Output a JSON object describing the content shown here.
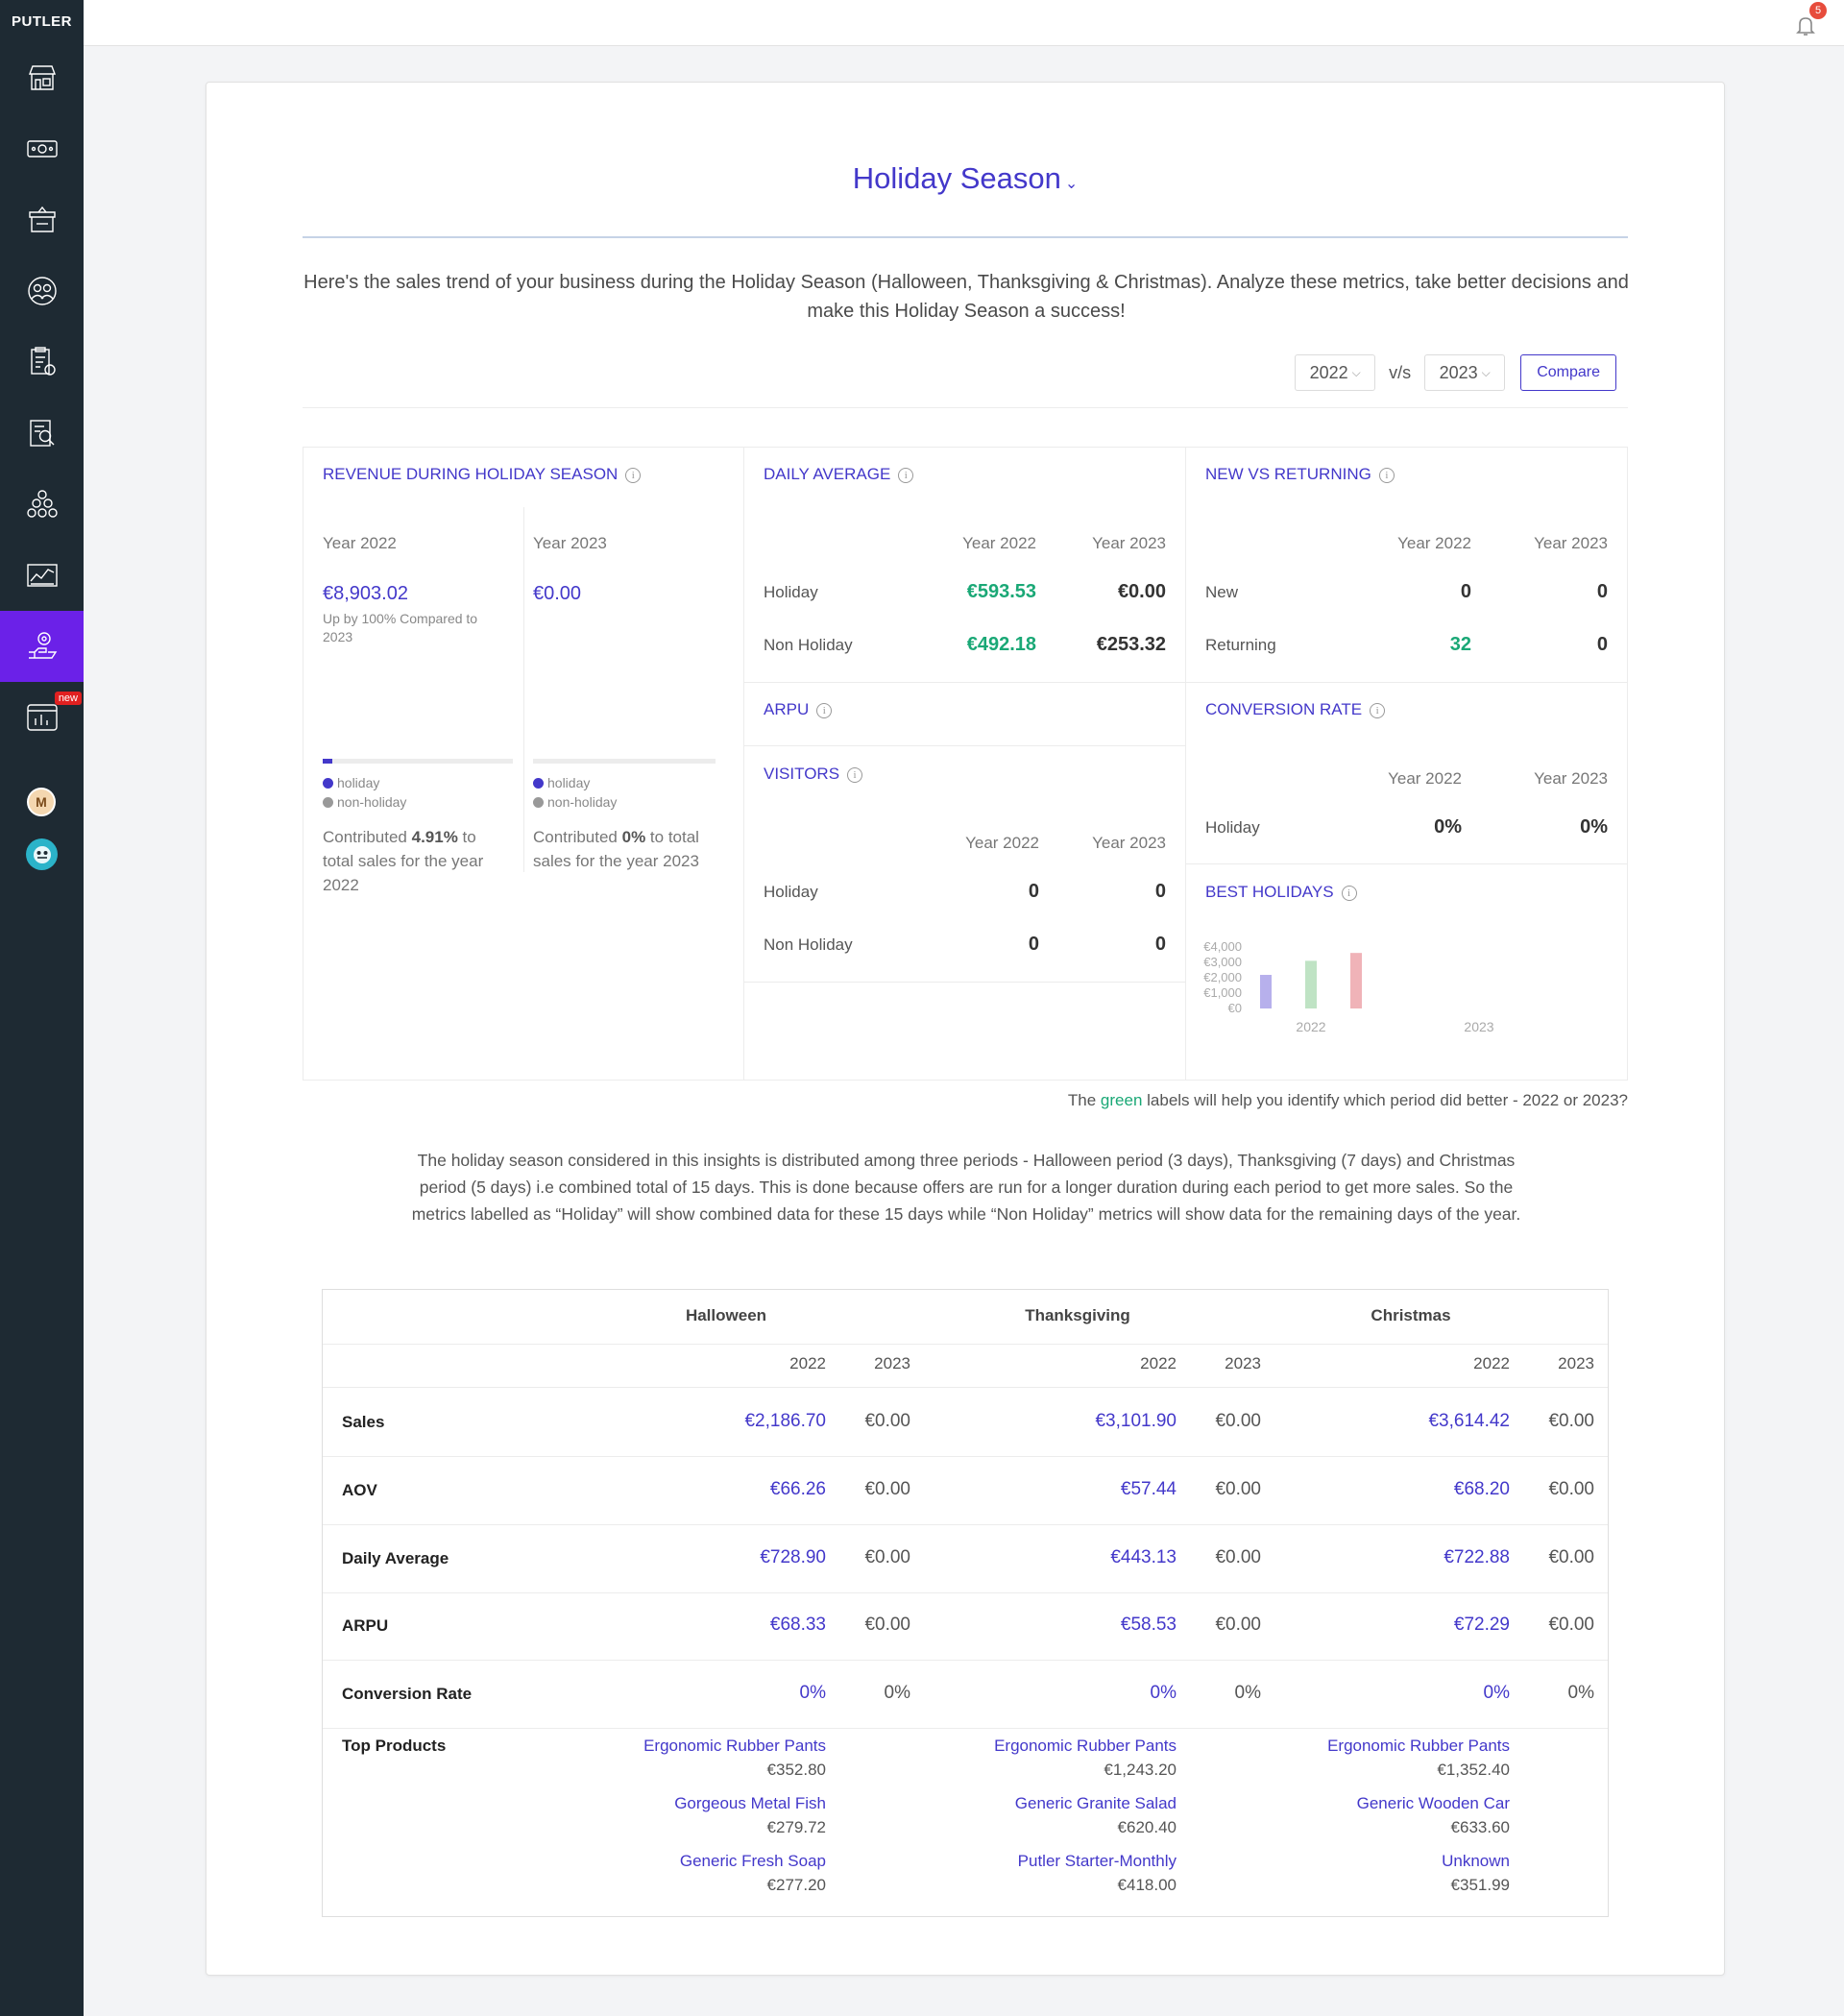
{
  "brand": "PUTLER",
  "sidebar": {
    "items": [
      {
        "icon": "store-icon"
      },
      {
        "icon": "money-icon"
      },
      {
        "icon": "product-box-icon"
      },
      {
        "icon": "customers-icon"
      },
      {
        "icon": "reports-icon"
      },
      {
        "icon": "audit-icon"
      },
      {
        "icon": "subscriptions-icon"
      },
      {
        "icon": "trend-chart-icon"
      },
      {
        "icon": "insights-icon",
        "active": true
      },
      {
        "icon": "dashboard-chart-icon",
        "badge": "new"
      }
    ],
    "avatar_letter": "M"
  },
  "topbar": {
    "notification_count": "5"
  },
  "header": {
    "title": "Holiday Season",
    "intro": "Here's the sales trend of your business during the Holiday Season (Halloween, Thanksgiving & Christmas). Analyze these metrics, take better decisions and make this Holiday Season a success!"
  },
  "compare": {
    "year_a": "2022",
    "vs": "v/s",
    "year_b": "2023",
    "button": "Compare"
  },
  "revenue": {
    "title": "REVENUE DURING HOLIDAY SEASON",
    "y1_label": "Year 2022",
    "y2_label": "Year 2023",
    "y1_value": "€8,903.02",
    "y2_value": "€0.00",
    "y1_sub": "Up by 100% Compared to 2023",
    "y1_holiday_share": 0.0491,
    "y2_holiday_share": 0,
    "legend_holiday": "holiday",
    "legend_nonholiday": "non-holiday",
    "y1_contrib_pre": "Contributed ",
    "y1_contrib_pct": "4.91%",
    "y1_contrib_post": " to total sales for the year 2022",
    "y2_contrib_pre": "Contributed ",
    "y2_contrib_pct": "0%",
    "y2_contrib_post": " to total sales for the year 2023"
  },
  "daily_average": {
    "title": "DAILY AVERAGE",
    "col1": "Year 2022",
    "col2": "Year 2023",
    "rows": [
      {
        "label": "Holiday",
        "v1": "€593.53",
        "v2": "€0.00"
      },
      {
        "label": "Non Holiday",
        "v1": "€492.18",
        "v2": "€253.32"
      }
    ]
  },
  "arpu": {
    "title": "ARPU"
  },
  "visitors": {
    "title": "VISITORS",
    "col1": "Year 2022",
    "col2": "Year 2023",
    "rows": [
      {
        "label": "Holiday",
        "v1": "0",
        "v2": "0"
      },
      {
        "label": "Non Holiday",
        "v1": "0",
        "v2": "0"
      }
    ]
  },
  "new_vs_returning": {
    "title": "NEW VS RETURNING",
    "col1": "Year 2022",
    "col2": "Year 2023",
    "rows": [
      {
        "label": "New",
        "v1": "0",
        "v2": "0"
      },
      {
        "label": "Returning",
        "v1": "32",
        "v2": "0"
      }
    ]
  },
  "conversion_rate": {
    "title": "CONVERSION RATE",
    "col1": "Year 2022",
    "col2": "Year 2023",
    "rows": [
      {
        "label": "Holiday",
        "v1": "0%",
        "v2": "0%"
      }
    ]
  },
  "best_holidays": {
    "title": "BEST HOLIDAYS"
  },
  "chart_data": {
    "type": "bar",
    "categories": [
      "2022",
      "2023"
    ],
    "y_ticks": [
      "€4,000",
      "€3,000",
      "€2,000",
      "€1,000",
      "€0"
    ],
    "ylim": [
      0,
      4000
    ],
    "series": [
      {
        "color": "#b7b0ec",
        "values": [
          2186.7,
          0
        ]
      },
      {
        "color": "#bfe3c4",
        "values": [
          3101.9,
          0
        ]
      },
      {
        "color": "#f0b3b8",
        "values": [
          3614.42,
          0
        ]
      }
    ]
  },
  "notes": {
    "green_pre": "The ",
    "green_word": "green",
    "green_post": " labels will help you identify which period did better - 2022 or 2023?",
    "description": "The holiday season considered in this insights is distributed among three periods - Halloween period (3 days), Thanksgiving (7 days) and Christmas period (5 days) i.e combined total of 15 days. This is done because offers are run for a longer duration during each period to get more sales. So the metrics labelled as “Holiday” will show combined data for these 15 days while “Non Holiday” metrics will show data for the remaining days of the year."
  },
  "table": {
    "groups": [
      "Halloween",
      "Thanksgiving",
      "Christmas"
    ],
    "years": [
      "2022",
      "2023"
    ],
    "rows": [
      {
        "label": "Sales",
        "values": [
          "€2,186.70",
          "€0.00",
          "€3,101.90",
          "€0.00",
          "€3,614.42",
          "€0.00"
        ]
      },
      {
        "label": "AOV",
        "values": [
          "€66.26",
          "€0.00",
          "€57.44",
          "€0.00",
          "€68.20",
          "€0.00"
        ]
      },
      {
        "label": "Daily Average",
        "values": [
          "€728.90",
          "€0.00",
          "€443.13",
          "€0.00",
          "€722.88",
          "€0.00"
        ]
      },
      {
        "label": "ARPU",
        "values": [
          "€68.33",
          "€0.00",
          "€58.53",
          "€0.00",
          "€72.29",
          "€0.00"
        ]
      },
      {
        "label": "Conversion Rate",
        "values": [
          "0%",
          "0%",
          "0%",
          "0%",
          "0%",
          "0%"
        ]
      }
    ],
    "top_products_label": "Top Products",
    "top_products": [
      [
        {
          "name": "Ergonomic Rubber Pants",
          "value": "€352.80"
        },
        {
          "name": "Gorgeous Metal Fish",
          "value": "€279.72"
        },
        {
          "name": "Generic Fresh Soap",
          "value": "€277.20"
        }
      ],
      [
        {
          "name": "Ergonomic Rubber Pants",
          "value": "€1,243.20"
        },
        {
          "name": "Generic Granite Salad",
          "value": "€620.40"
        },
        {
          "name": "Putler Starter-Monthly",
          "value": "€418.00"
        }
      ],
      [
        {
          "name": "Ergonomic Rubber Pants",
          "value": "€1,352.40"
        },
        {
          "name": "Generic Wooden Car",
          "value": "€633.60"
        },
        {
          "name": "Unknown",
          "value": "€351.99"
        }
      ]
    ]
  }
}
